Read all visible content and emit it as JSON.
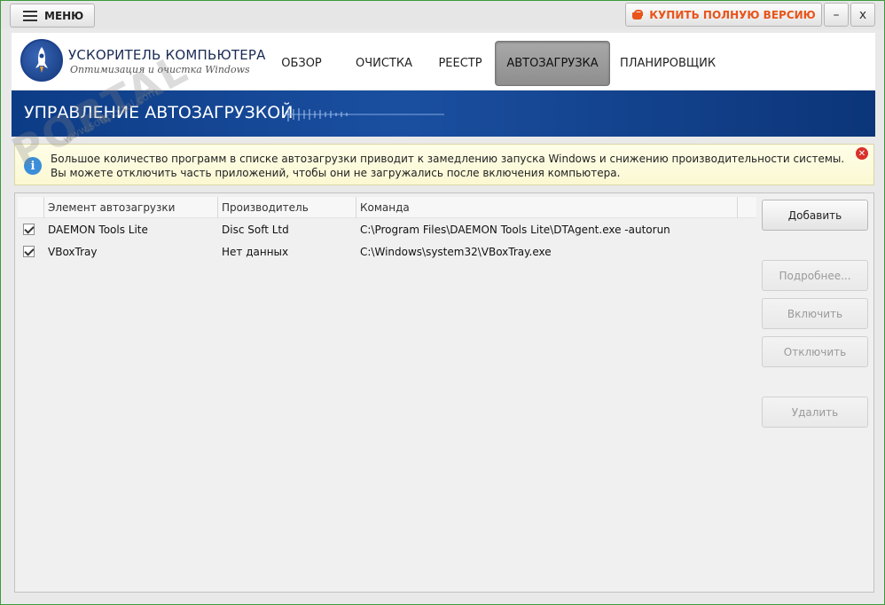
{
  "topbar": {
    "menu_label": "МЕНЮ",
    "buy_label": "КУПИТЬ ПОЛНУЮ ВЕРСИЮ",
    "minimize_label": "–",
    "close_label": "x"
  },
  "logo": {
    "title": "УСКОРИТЕЛЬ КОМПЬЮТЕРА",
    "subtitle": "Оптимизация и очистка Windows"
  },
  "nav": {
    "tabs": [
      {
        "label": "ОБЗОР"
      },
      {
        "label": "ОЧИСТКА"
      },
      {
        "label": "РЕЕСТР"
      },
      {
        "label": "АВТОЗАГРУЗКА",
        "active": true
      },
      {
        "label": "ПЛАНИРОВЩИК"
      }
    ]
  },
  "banner": {
    "title": "УПРАВЛЕНИЕ АВТОЗАГРУЗКОЙ"
  },
  "info": {
    "icon": "info-icon",
    "line1": "Большое количество программ в списке автозагрузки приводит к замедлению запуска Windows и снижению производительности системы.",
    "line2": "Вы можете отключить часть приложений, чтобы они не загружались после включения компьютера."
  },
  "table": {
    "columns": [
      "Элемент автозагрузки",
      "Производитель",
      "Команда"
    ],
    "rows": [
      {
        "checked": true,
        "name": "DAEMON Tools Lite",
        "vendor": "Disc Soft Ltd",
        "command": "C:\\Program Files\\DAEMON Tools Lite\\DTAgent.exe -autorun"
      },
      {
        "checked": true,
        "name": "VBoxTray",
        "vendor": "Нет данных",
        "command": "C:\\Windows\\system32\\VBoxTray.exe"
      }
    ]
  },
  "actions": {
    "add": "Добавить",
    "details": "Подробнее...",
    "enable": "Включить",
    "disable": "Отключить",
    "delete": "Удалить"
  },
  "watermark": {
    "text": "PORTAL",
    "url": "www.softportal.com"
  },
  "colors": {
    "accent_buy": "#e8541a",
    "banner": "#0d3c86",
    "info_bg": "#fbf8d2",
    "frame": "#3c9a3c"
  }
}
